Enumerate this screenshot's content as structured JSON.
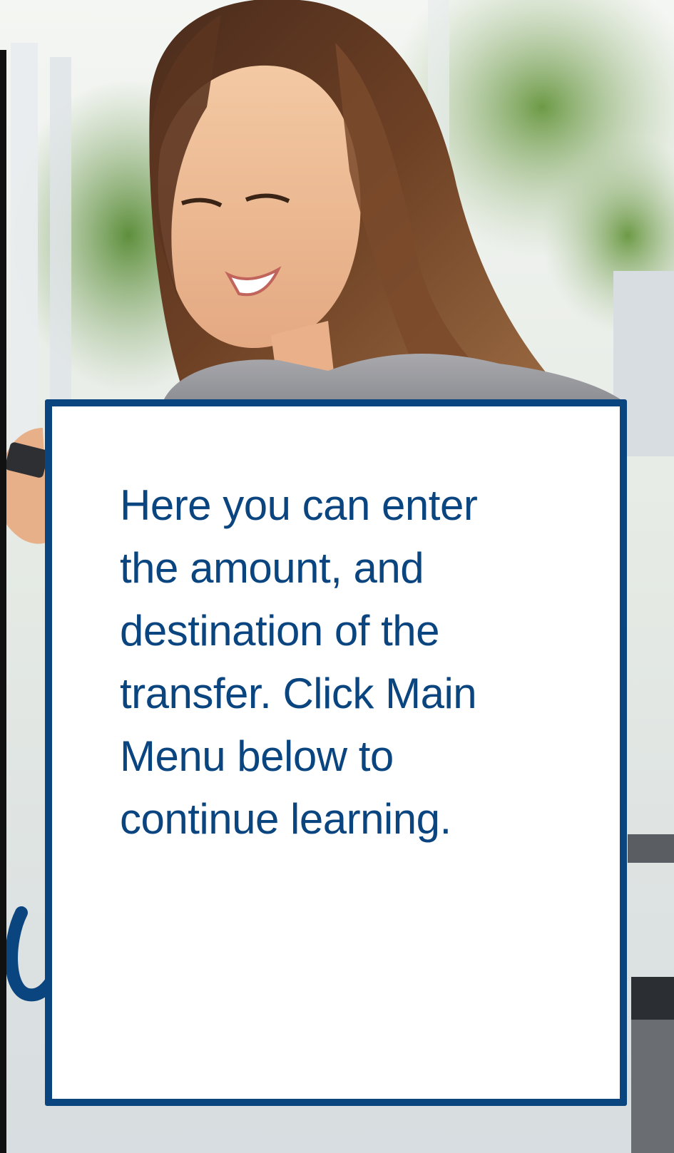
{
  "callout": {
    "text": "Here you can enter\nthe amount, and\ndestination of the\ntransfer.  Click Main\nMenu below to\ncontinue learning."
  },
  "colors": {
    "callout_border": "#0b4580",
    "callout_text": "#0b4580",
    "callout_background": "#ffffff"
  }
}
